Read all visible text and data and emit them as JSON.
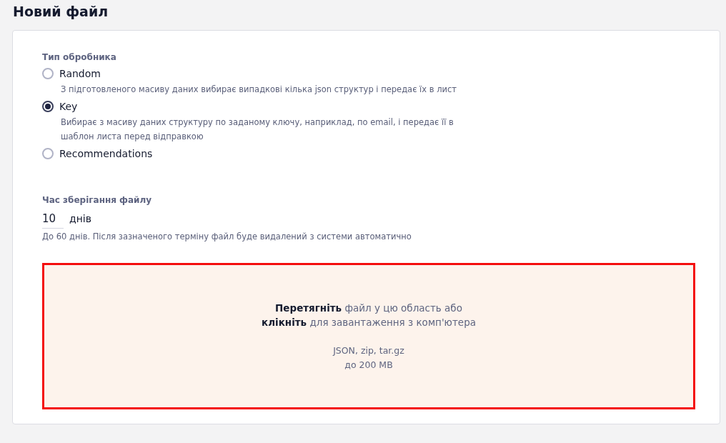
{
  "page_title": "Новий файл",
  "handler_type": {
    "label": "Тип обробника",
    "options": [
      {
        "label": "Random",
        "description": "З підготовленого масиву даних вибирає випадкові кілька json структур і передає їх в лист",
        "selected": false
      },
      {
        "label": "Key",
        "description": "Вибирає з масиву даних структуру по заданому ключу, наприклад, по email, і передає її в шаблон листа перед відправкою",
        "selected": true
      },
      {
        "label": "Recommendations",
        "selected": false
      }
    ]
  },
  "storage_time": {
    "label": "Час зберігання файлу",
    "value": "10",
    "unit": "днів",
    "hint": "До 60 днів. Після зазначеного терміну файл буде видалений з системи автоматично"
  },
  "dropzone": {
    "lines": [
      "**Перетягніть** файл у цю область або",
      "**клікніть** для завантаження з комп'ютера"
    ],
    "formats": "JSON, zip, tar.gz",
    "max_size": "до 200 MB"
  }
}
